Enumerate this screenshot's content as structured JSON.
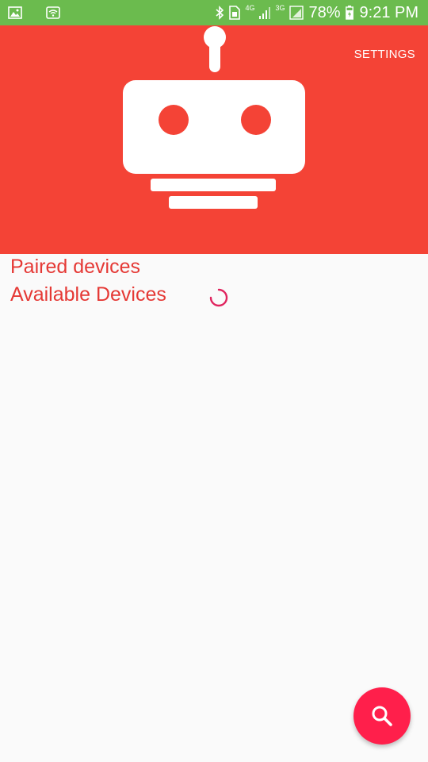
{
  "status_bar": {
    "network_4g": "4G",
    "network_3g": "3G",
    "battery_percent": "78%",
    "time": "9:21 PM"
  },
  "header": {
    "settings_label": "SETTINGS",
    "background_color": "#f44336",
    "logo_icon": "robot-icon"
  },
  "main": {
    "paired_title": "Paired devices",
    "available_title": "Available Devices",
    "loading": true
  },
  "fab": {
    "icon": "search-icon",
    "color": "#ff1f4b"
  },
  "colors": {
    "status_bar": "#6bbb4e",
    "accent_text": "#e53935",
    "background": "#fafafa"
  }
}
